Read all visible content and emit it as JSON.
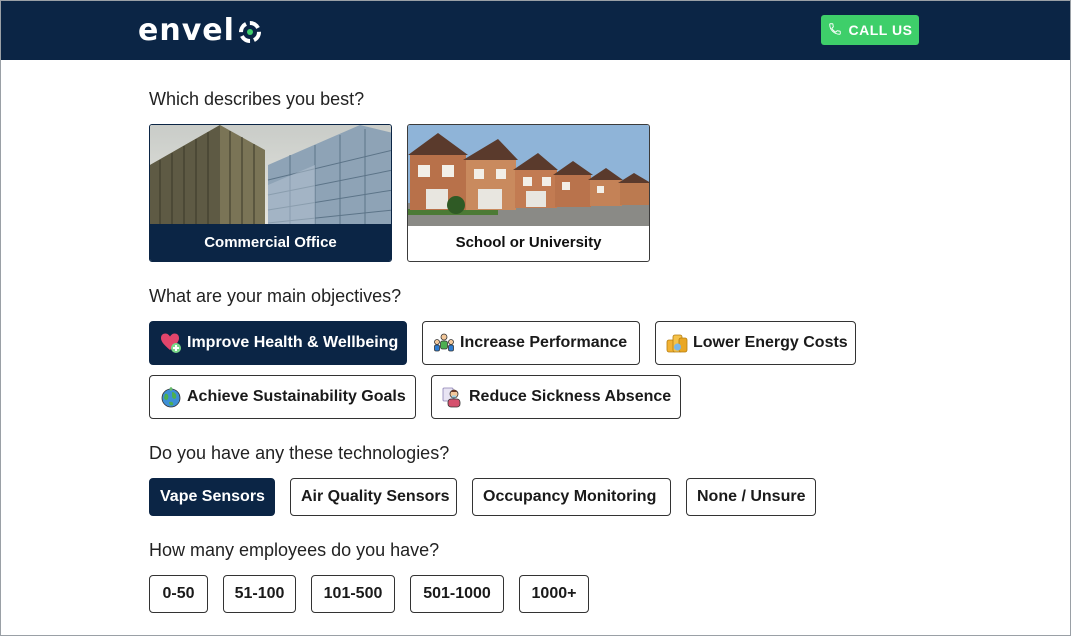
{
  "header": {
    "logo_text": "envel",
    "call_label": "CALL US",
    "colors": {
      "navy": "#0b2545",
      "green": "#3ecf6a"
    }
  },
  "questions": {
    "describes": "Which describes you best?",
    "objectives": "What are your main objectives?",
    "technologies": "Do you have any these technologies?",
    "employees": "How many employees do you have?"
  },
  "building_types": [
    {
      "label": "Commercial Office",
      "selected": true,
      "image": "office-building-photo"
    },
    {
      "label": "School or University",
      "selected": false,
      "image": "houses-photo"
    }
  ],
  "objectives": [
    {
      "label": "Improve Health & Wellbeing",
      "icon": "heart-plus-icon",
      "selected": true
    },
    {
      "label": "Increase Performance",
      "icon": "team-icon",
      "selected": false
    },
    {
      "label": "Lower Energy Costs",
      "icon": "coins-icon",
      "selected": false
    },
    {
      "label": "Achieve Sustainability Goals",
      "icon": "globe-icon",
      "selected": false
    },
    {
      "label": "Reduce Sickness Absence",
      "icon": "sick-person-icon",
      "selected": false
    }
  ],
  "technologies": [
    {
      "label": "Vape Sensors",
      "selected": true
    },
    {
      "label": "Air Quality Sensors",
      "selected": false
    },
    {
      "label": "Occupancy Monitoring",
      "selected": false
    },
    {
      "label": "None / Unsure",
      "selected": false
    }
  ],
  "employees": [
    {
      "label": "0-50"
    },
    {
      "label": "51-100"
    },
    {
      "label": "101-500"
    },
    {
      "label": "501-1000"
    },
    {
      "label": "1000+"
    }
  ]
}
